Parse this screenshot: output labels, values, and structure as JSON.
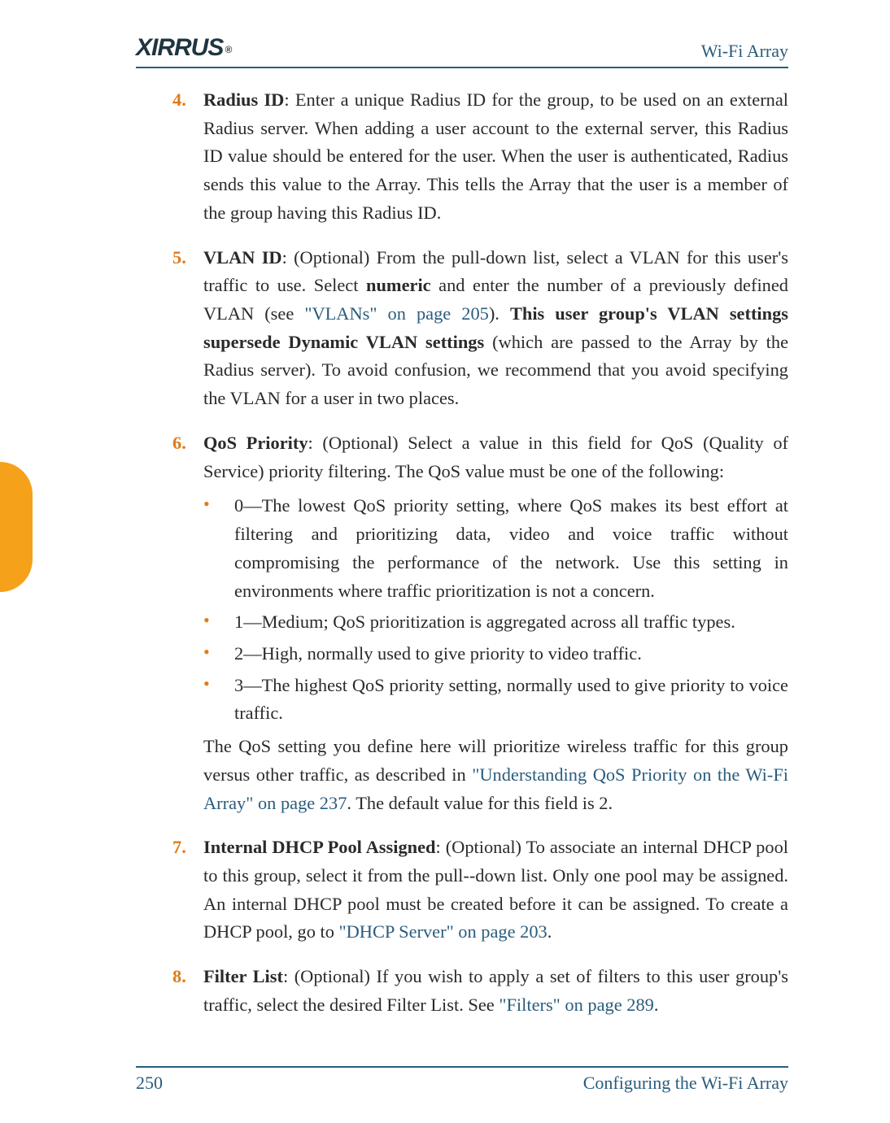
{
  "header": {
    "logo_text": "XIRRUS",
    "reg": "®",
    "product": "Wi-Fi Array"
  },
  "items": [
    {
      "num": "4.",
      "title": "Radius ID",
      "text_after_title": ": Enter a unique Radius ID for the group, to be used on an external Radius server. When adding a user account to the external server, this Radius ID value should be entered for the user. When the user is authenticated, Radius sends this value to the Array. This tells the Array that the user is a member of the group having this Radius ID."
    },
    {
      "num": "5.",
      "title": "VLAN ID",
      "pre": ": (Optional) From the pull-down list, select a VLAN for this user's traffic to use. Select ",
      "bold1": "numeric",
      "mid1": " and enter the number of a previously defined VLAN (see ",
      "link1": "\"VLANs\" on page 205",
      "mid2": "). ",
      "bold2": "This user group's VLAN settings supersede Dynamic VLAN settings",
      "post": " (which are passed to the Array by the Radius server). To avoid confusion, we recommend that you avoid specifying the VLAN for a user in two places."
    },
    {
      "num": "6.",
      "title": "QoS Priority",
      "intro": ": (Optional) Select a value in this field for QoS (Quality of Service) priority filtering. The QoS value must be one of the following:",
      "bullets": [
        "0—The lowest QoS priority setting, where QoS makes its best effort at filtering and prioritizing data, video and voice traffic without compromising the performance of the network. Use this setting in environments where traffic prioritization is not a concern.",
        "1—Medium; QoS prioritization is aggregated across all traffic types.",
        "2—High, normally used to give priority to video traffic.",
        "3—The highest QoS priority setting, normally used to give priority to voice traffic."
      ],
      "note_pre": "The QoS setting you define here will prioritize wireless traffic for this group versus other traffic, as described in ",
      "note_link": "\"Understanding QoS Priority on the Wi-Fi Array\" on page 237",
      "note_post": ". The default value for this field is 2."
    },
    {
      "num": "7.",
      "title": "Internal DHCP Pool Assigned",
      "pre": ": (Optional) To associate an internal DHCP pool to this group, select it from the pull--down list. Only one pool may be assigned. An internal DHCP pool must be created before it can be assigned. To create a DHCP pool, go to ",
      "link": "\"DHCP Server\" on page 203",
      "post": "."
    },
    {
      "num": "8.",
      "title": "Filter List",
      "pre": ": (Optional) If you wish to apply a set of filters to this user group's traffic, select the desired Filter List. See ",
      "link": "\"Filters\" on page 289",
      "post": "."
    }
  ],
  "footer": {
    "page": "250",
    "section": "Configuring the Wi-Fi Array"
  }
}
